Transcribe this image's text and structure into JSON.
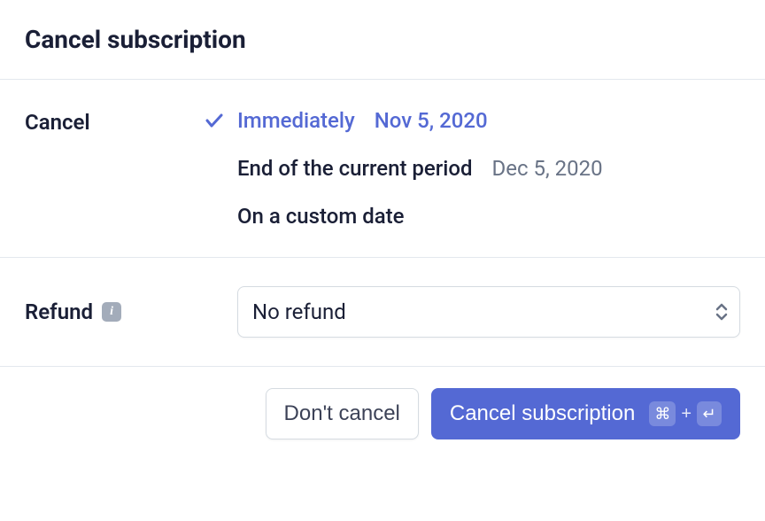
{
  "header": {
    "title": "Cancel subscription"
  },
  "cancel": {
    "label": "Cancel",
    "options": {
      "immediately": {
        "label": "Immediately",
        "date": "Nov 5, 2020"
      },
      "end_period": {
        "label": "End of the current period",
        "date": "Dec 5, 2020"
      },
      "custom": {
        "label": "On a custom date"
      }
    }
  },
  "refund": {
    "label": "Refund",
    "selected": "No refund"
  },
  "footer": {
    "dont_cancel": "Don't cancel",
    "cancel_subscription": "Cancel subscription",
    "kbd_plus": "+"
  }
}
